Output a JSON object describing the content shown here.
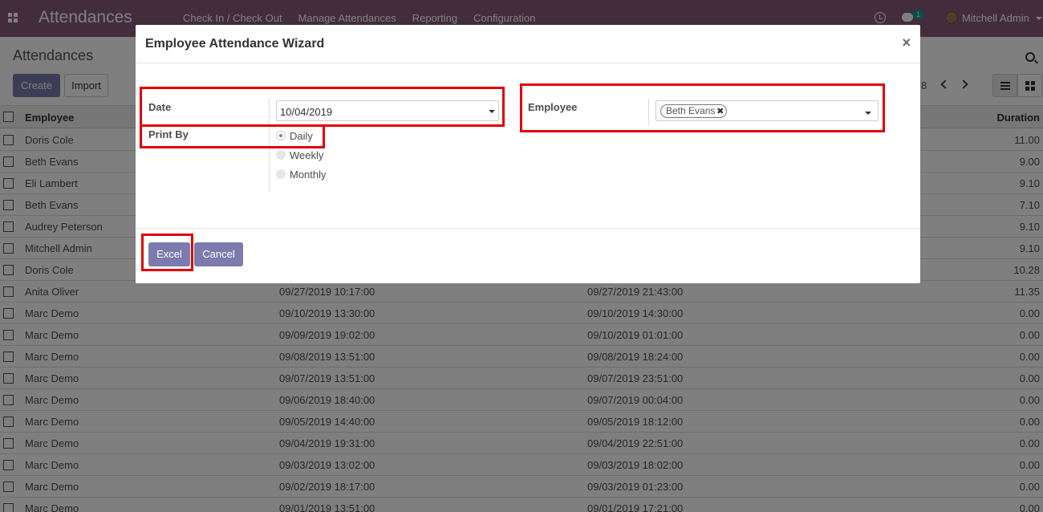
{
  "navbar": {
    "app_title": "Attendances",
    "menu": [
      "Check In / Check Out",
      "Manage Attendances",
      "Reporting",
      "Configuration"
    ],
    "chat_badge": "1",
    "user_name": "Mitchell Admin"
  },
  "control": {
    "breadcrumb": "Attendances",
    "create_label": "Create",
    "import_label": "Import",
    "pager_partial": "8"
  },
  "list": {
    "headers": {
      "employee": "Employee",
      "duration": "Duration"
    },
    "rows": [
      {
        "employee": "Doris Cole",
        "check_in": "",
        "check_out": "",
        "duration": "11.00"
      },
      {
        "employee": "Beth Evans",
        "check_in": "",
        "check_out": "",
        "duration": "9.00"
      },
      {
        "employee": "Eli Lambert",
        "check_in": "",
        "check_out": "",
        "duration": "9.10"
      },
      {
        "employee": "Beth Evans",
        "check_in": "",
        "check_out": "",
        "duration": "7.10"
      },
      {
        "employee": "Audrey Peterson",
        "check_in": "",
        "check_out": "",
        "duration": "9.10"
      },
      {
        "employee": "Mitchell Admin",
        "check_in": "",
        "check_out": "",
        "duration": "9.10"
      },
      {
        "employee": "Doris Cole",
        "check_in": "",
        "check_out": "",
        "duration": "10.28"
      },
      {
        "employee": "Anita Oliver",
        "check_in": "09/27/2019 10:17:00",
        "check_out": "09/27/2019 21:43:00",
        "duration": "11.35"
      },
      {
        "employee": "Marc Demo",
        "check_in": "09/10/2019 13:30:00",
        "check_out": "09/10/2019 14:30:00",
        "duration": "0.00"
      },
      {
        "employee": "Marc Demo",
        "check_in": "09/09/2019 19:02:00",
        "check_out": "09/10/2019 01:01:00",
        "duration": "0.00"
      },
      {
        "employee": "Marc Demo",
        "check_in": "09/08/2019 13:51:00",
        "check_out": "09/08/2019 18:24:00",
        "duration": "0.00"
      },
      {
        "employee": "Marc Demo",
        "check_in": "09/07/2019 13:51:00",
        "check_out": "09/07/2019 23:51:00",
        "duration": "0.00"
      },
      {
        "employee": "Marc Demo",
        "check_in": "09/06/2019 18:40:00",
        "check_out": "09/07/2019 00:04:00",
        "duration": "0.00"
      },
      {
        "employee": "Marc Demo",
        "check_in": "09/05/2019 14:40:00",
        "check_out": "09/05/2019 18:12:00",
        "duration": "0.00"
      },
      {
        "employee": "Marc Demo",
        "check_in": "09/04/2019 19:31:00",
        "check_out": "09/04/2019 22:51:00",
        "duration": "0.00"
      },
      {
        "employee": "Marc Demo",
        "check_in": "09/03/2019 13:02:00",
        "check_out": "09/03/2019 18:02:00",
        "duration": "0.00"
      },
      {
        "employee": "Marc Demo",
        "check_in": "09/02/2019 18:17:00",
        "check_out": "09/03/2019 01:23:00",
        "duration": "0.00"
      },
      {
        "employee": "Marc Demo",
        "check_in": "09/01/2019 13:51:00",
        "check_out": "09/01/2019 17:21:00",
        "duration": "0.00"
      }
    ]
  },
  "wizard": {
    "title": "Employee Attendance Wizard",
    "close_label": "×",
    "date_label": "Date",
    "date_value": "10/04/2019",
    "print_by_label": "Print By",
    "print_by_options": [
      "Daily",
      "Weekly",
      "Monthly"
    ],
    "print_by_selected": "Daily",
    "employee_label": "Employee",
    "employee_tags": [
      "Beth Evans"
    ],
    "excel_label": "Excel",
    "cancel_label": "Cancel"
  },
  "colors": {
    "navbar": "#875a7b",
    "primary_button": "#7c7bad",
    "highlight": "#e00000"
  }
}
